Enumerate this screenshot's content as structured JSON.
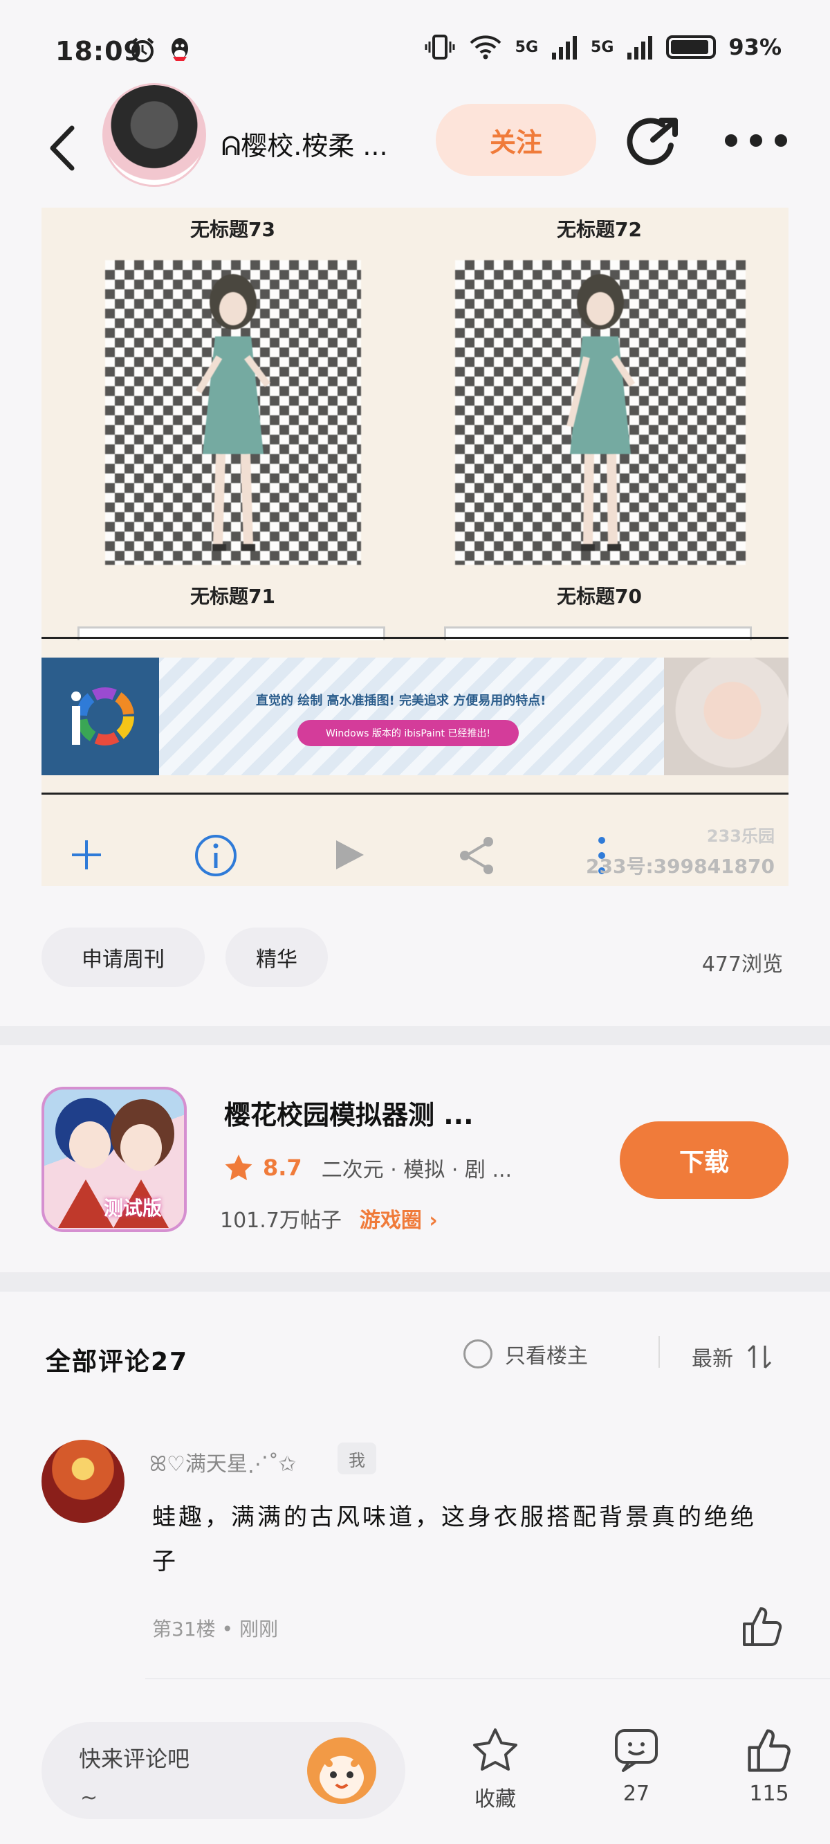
{
  "status_bar": {
    "time": "18:09",
    "network_1": "5G",
    "network_2": "5G",
    "battery": "93%"
  },
  "header": {
    "author_name": "ᕱ樱校.桉柔 ...",
    "follow_label": "关注"
  },
  "post_image": {
    "gallery_titles": [
      "无标题73",
      "无标题72",
      "无标题71",
      "无标题70"
    ],
    "ibis_text": "直觉的 绘制 高水准插图! 完美追求 方便易用的特点!",
    "ibis_pill": "Windows 版本的 ibisPaint 已经推出!",
    "watermark_1": "233乐园",
    "watermark_2": "233号:399841870"
  },
  "tags": [
    "申请周刊",
    "精华"
  ],
  "views": "477浏览",
  "game_card": {
    "title": "樱花校园模拟器测 ...",
    "rating": "8.7",
    "categories": "二次元 · 模拟 · 剧 ...",
    "post_count": "101.7万帖子",
    "circle_label": "游戏圈",
    "download_label": "下载",
    "icon_badge": "测试版"
  },
  "comments": {
    "title": "全部评论27",
    "only_op_label": "只看楼主",
    "sort_label": "最新"
  },
  "comment_1": {
    "username": "ꕤ♡满天星⋰˚✩",
    "me_badge": "我",
    "text": "蛙趣，满满的古风味道，这身衣服搭配背景真的绝绝子",
    "floor": "第31楼",
    "time": "刚刚"
  },
  "bottom_bar": {
    "comment_placeholder": "快来评论吧",
    "comment_tilde": "~",
    "favorite_label": "收藏",
    "comment_count": "27",
    "like_count": "115"
  },
  "colors": {
    "accent": "#f07b3a",
    "follow_bg": "#fde4da",
    "page_bg": "#f7f6f8"
  }
}
